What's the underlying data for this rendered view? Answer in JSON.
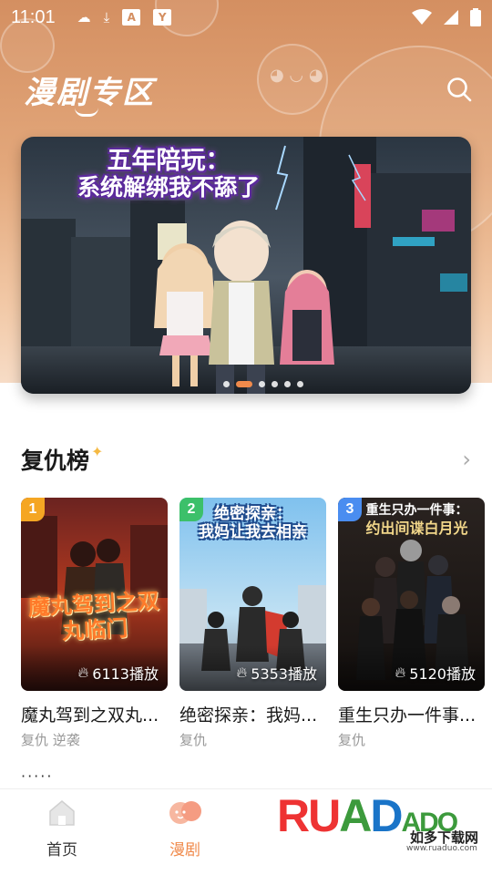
{
  "status_bar": {
    "time": "11:01",
    "icons": [
      "notification-icon",
      "download-icon",
      "a-badge-icon",
      "y-badge-icon",
      "wifi-icon",
      "signal-icon",
      "battery-icon"
    ],
    "box_a": "A",
    "box_y": "Y"
  },
  "header": {
    "title": "漫剧专区",
    "search_icon": "search-icon"
  },
  "banner": {
    "title_line1": "五年陪玩：",
    "title_line2": "系统解绑我不舔了",
    "dots_count": 6,
    "active_dot": 1
  },
  "section": {
    "title": "复仇榜",
    "more_icon": "chevron-right-icon"
  },
  "cards": [
    {
      "rank": "1",
      "cover_text": "魔丸驾到之双丸临门",
      "plays": "6113播放",
      "name": "魔丸驾到之双丸...",
      "tags": "复仇 逆袭"
    },
    {
      "rank": "2",
      "cover_text_l1": "绝密探亲：",
      "cover_text_l2": "我妈让我去相亲",
      "plays": "5353播放",
      "name": "绝密探亲：我妈...",
      "tags": "复仇"
    },
    {
      "rank": "3",
      "cover_text_l1": "重生只办一件事：",
      "cover_text_l2": "约出间谍白月光",
      "plays": "5120播放",
      "name": "重生只办一件事...",
      "tags": "复仇"
    }
  ],
  "next_section_hint": "·····",
  "bottom_nav": {
    "home_label": "首页",
    "drama_label": "漫剧",
    "active": "漫剧"
  },
  "watermark": {
    "logo_r": "RU",
    "logo_a": "A",
    "logo_d": "D",
    "logo_rest": "ADO",
    "cn": "如多下载网",
    "url": "www.ruaduo.com"
  },
  "colors": {
    "accent": "#f08a4b",
    "header_bg": "#d48f61",
    "rank1": "#f5a623",
    "rank2": "#3cc06a",
    "rank3": "#4a8df0"
  }
}
